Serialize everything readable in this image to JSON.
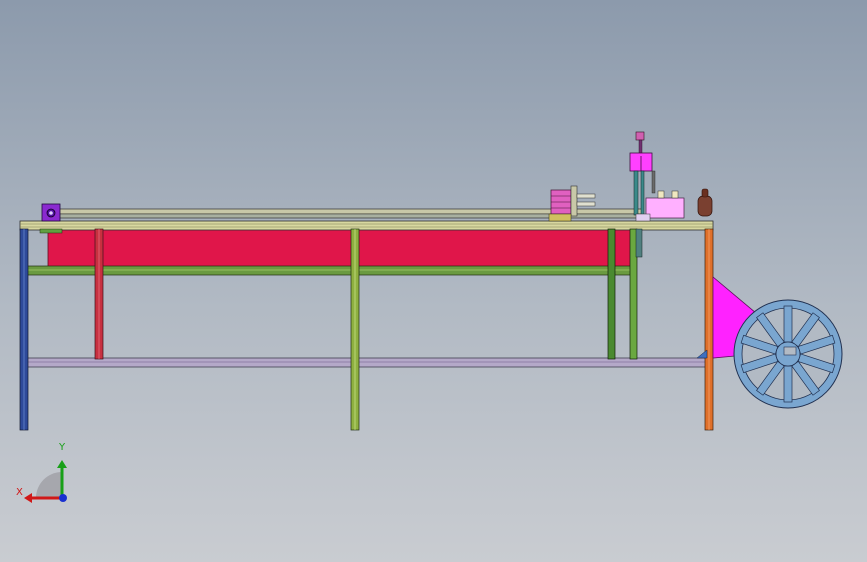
{
  "view": {
    "background_top": "#8c9aac",
    "background_bottom": "#c9ccd1"
  },
  "triad": {
    "x_label": "X",
    "y_label": "Y",
    "x_color": "#d01818",
    "y_color": "#18a018",
    "z_color": "#1830d0"
  },
  "colors": {
    "frame_top": "#d8d8a0",
    "red_panel": "#e0164a",
    "magenta_bracket": "#ff22ff",
    "wheel": "#7aa6d0",
    "leg_blue": "#2e4a9a",
    "leg_red": "#c83040",
    "leg_green": "#8eb040",
    "leg_orange": "#e0702a"
  }
}
